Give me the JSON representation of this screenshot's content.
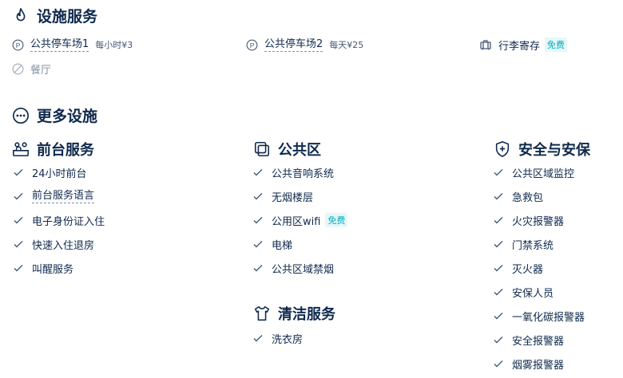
{
  "facilities": {
    "title": "设施服务",
    "items": [
      {
        "name": "公共停车场1",
        "note": "每小时¥3",
        "icon": "parking-icon"
      },
      {
        "name": "公共停车场2",
        "note": "每天¥25",
        "icon": "parking-icon"
      },
      {
        "name": "行李寄存",
        "badge": "免费",
        "icon": "luggage-icon"
      },
      {
        "name": "餐厅",
        "icon": "unavailable-icon"
      }
    ]
  },
  "more": {
    "title": "更多设施",
    "groups": [
      {
        "title": "前台服务",
        "icon": "front-desk-icon",
        "items": [
          "24小时前台",
          "前台服务语言",
          "电子身份证入住",
          "快速入住退房",
          "叫醒服务"
        ]
      },
      {
        "title": "公共区",
        "icon": "public-area-icon",
        "items": [
          "公共音响系统",
          "无烟楼层",
          "公用区wifi",
          "电梯",
          "公共区域禁烟"
        ],
        "wifi_badge": "免费"
      },
      {
        "title": "清洁服务",
        "icon": "shirt-icon",
        "items": [
          "洗衣房"
        ]
      },
      {
        "title": "安全与安保",
        "icon": "shield-icon",
        "items": [
          "公共区域监控",
          "急救包",
          "火灾报警器",
          "门禁系统",
          "灭火器",
          "安保人员",
          "一氧化碳报警器",
          "安全报警器",
          "烟雾报警器"
        ]
      }
    ]
  },
  "colors": {
    "text": "#0f294d",
    "muted": "#8592a6",
    "free": "#06aebd"
  }
}
